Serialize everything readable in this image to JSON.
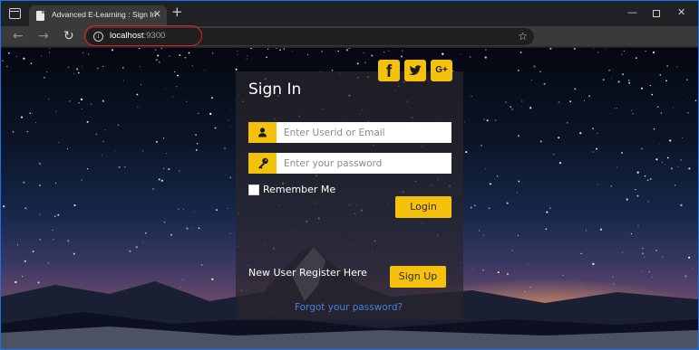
{
  "browser": {
    "tab_title": "Advanced E-Learning : Sign In",
    "tab_close": "✕",
    "new_tab": "+",
    "url_host": "localhost",
    "url_port": ":9300",
    "window_min": "—",
    "window_close": "✕"
  },
  "signin": {
    "title": "Sign In",
    "social": {
      "facebook": "f",
      "googleplus": "G+"
    },
    "userid_placeholder": "Enter Userid or Email",
    "password_placeholder": "Enter your password",
    "remember_label": "Remember Me",
    "login_label": "Login",
    "register_text": "New User Register Here",
    "signup_label": "Sign Up",
    "forgot_label": "Forgot your password?"
  },
  "colors": {
    "accent": "#f4c20d",
    "link": "#4a7fe0",
    "highlight": "#e0202a"
  }
}
